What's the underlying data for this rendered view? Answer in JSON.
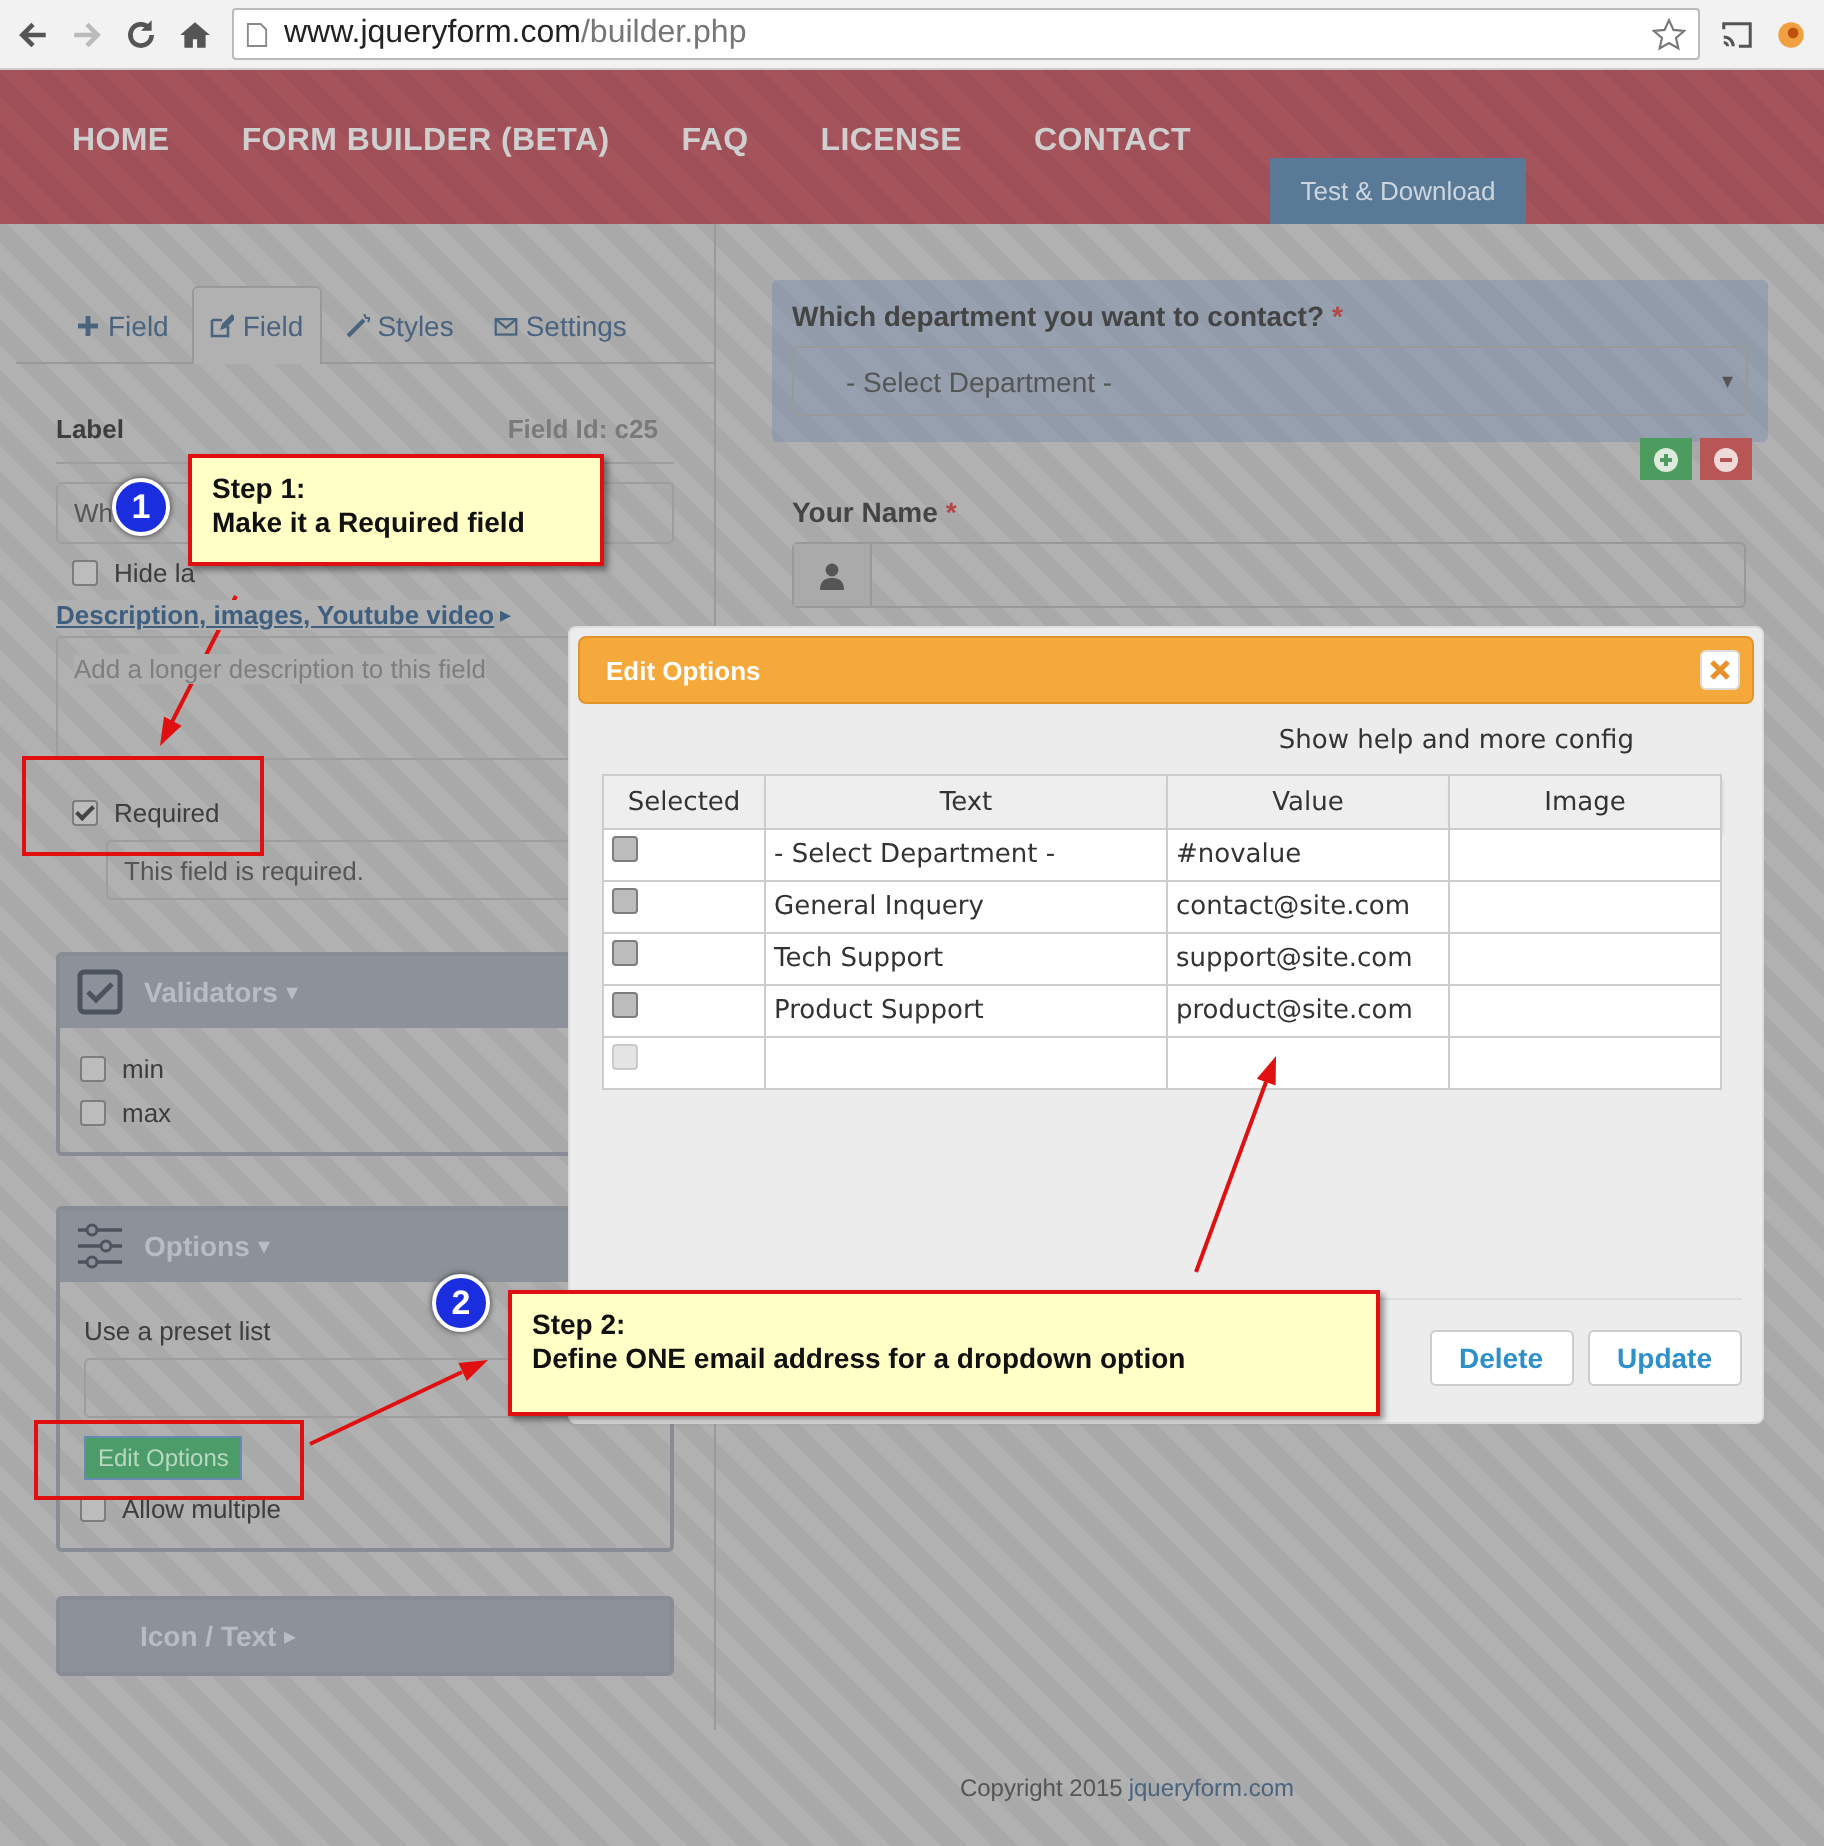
{
  "browser": {
    "url_host": "www.jqueryform.com",
    "url_path": "/builder.php"
  },
  "nav": {
    "items": [
      {
        "label": "HOME"
      },
      {
        "label": "FORM BUILDER (BETA)"
      },
      {
        "label": "FAQ"
      },
      {
        "label": "LICENSE"
      },
      {
        "label": "CONTACT"
      }
    ],
    "test_tab": "Test & Download"
  },
  "editor": {
    "tabs": [
      {
        "label": "Field",
        "kind": "add",
        "selected": false
      },
      {
        "label": "Field",
        "kind": "edit",
        "selected": true
      },
      {
        "label": "Styles",
        "kind": "styles",
        "selected": false
      },
      {
        "label": "Settings",
        "kind": "settings",
        "selected": false
      }
    ],
    "label_heading": "Label",
    "field_id": "Field Id: c25",
    "label_value": "Wh",
    "hide_label": {
      "label": "Hide la",
      "checked": false
    },
    "description_link": "Description, images, Youtube video",
    "description_caret": "▸",
    "description_placeholder": "Add a longer description to this field",
    "required": {
      "label": "Required",
      "checked": true
    },
    "required_message": "This field is required.",
    "validators": {
      "title": "Validators",
      "caret": "▾",
      "items": [
        {
          "label": "min",
          "checked": false
        },
        {
          "label": "max",
          "checked": false
        }
      ]
    },
    "options": {
      "title": "Options",
      "caret": "▾",
      "preset_label": "Use a preset list",
      "edit_button": "Edit Options",
      "allow_multiple": {
        "label": "Allow multiple",
        "checked": false
      }
    },
    "icon_text": {
      "title": "Icon / Text",
      "caret": "▸"
    }
  },
  "form": {
    "department": {
      "label": "Which department you want to contact?",
      "mark": "*",
      "placeholder": "- Select Department -",
      "caret": "▾"
    },
    "name": {
      "label": "Your Name",
      "mark": "*"
    }
  },
  "modal": {
    "title": "Edit Options",
    "help_link": "Show help and more config",
    "columns": [
      "Selected",
      "Text",
      "Value",
      "Image"
    ],
    "rows": [
      {
        "kind": "option",
        "selected": false,
        "text": "- Select Department -",
        "value": "#novalue"
      },
      {
        "kind": "option",
        "selected": false,
        "text": "General Inquery",
        "value": "contact@site.com"
      },
      {
        "kind": "option",
        "selected": false,
        "text": "Tech Support",
        "value": "support@site.com"
      },
      {
        "kind": "option",
        "selected": false,
        "text": "Product Support",
        "value": "product@site.com"
      },
      {
        "kind": "new",
        "selected": false
      }
    ],
    "buttons": [
      "Delete",
      "Update"
    ]
  },
  "callouts": [
    {
      "number": "1",
      "title": "Step 1:",
      "text": "Make it a Required field"
    },
    {
      "number": "2",
      "title": "Step 2:",
      "text": "Define ONE email address for a dropdown option"
    }
  ],
  "footer": {
    "text": "Copyright 2015",
    "link": "jqueryform.com"
  }
}
